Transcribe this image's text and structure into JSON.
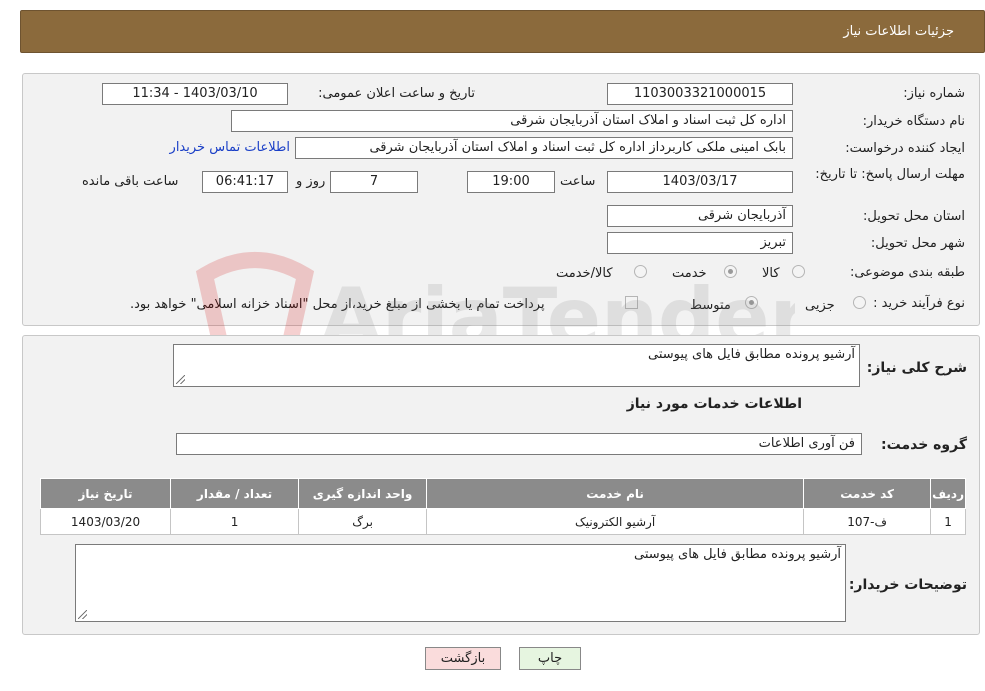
{
  "header": {
    "title": "جزئیات اطلاعات نیاز"
  },
  "form": {
    "need_number_label": "شماره نیاز:",
    "need_number": "1103003321000015",
    "announce_label": "تاریخ و ساعت اعلان عمومی:",
    "announce_value": "1403/03/10 - 11:34",
    "buyer_org_label": "نام دستگاه خریدار:",
    "buyer_org": "اداره کل ثبت اسناد و املاک استان آذربایجان شرقی",
    "creator_label": "ایجاد کننده درخواست:",
    "creator": "بابک امینی ملکی کاربرداز اداره کل ثبت اسناد و املاک استان آذربایجان شرقی",
    "contact_link": "اطلاعات تماس خریدار",
    "deadline_label": "مهلت ارسال پاسخ: تا تاریخ:",
    "deadline_date": "1403/03/17",
    "time_label": "ساعت",
    "deadline_time": "19:00",
    "days_value": "7",
    "days_label": "روز و",
    "remaining_time": "06:41:17",
    "remaining_label": "ساعت باقی مانده",
    "province_label": "استان محل تحویل:",
    "province": "آذربایجان شرقی",
    "city_label": "شهر محل تحویل:",
    "city": "تبریز",
    "category_label": "طبقه بندی موضوعی:",
    "category_options": [
      {
        "label": "کالا",
        "checked": false
      },
      {
        "label": "خدمت",
        "checked": true
      },
      {
        "label": "کالا/خدمت",
        "checked": false
      }
    ],
    "process_label": "نوع فرآیند خرید :",
    "process_options": [
      {
        "label": "جزیی",
        "checked": false
      },
      {
        "label": "متوسط",
        "checked": true
      }
    ],
    "payment_note": "پرداخت تمام یا بخشی از مبلغ خرید،از محل \"اسناد خزانه اسلامی\" خواهد بود."
  },
  "details": {
    "summary_label": "شرح کلی نیاز:",
    "summary": "آرشیو پرونده  مطابق فایل های پیوستی",
    "services_title": "اطلاعات خدمات مورد نیاز",
    "service_group_label": "گروه خدمت:",
    "service_group": "فن آوری اطلاعات",
    "table": {
      "headers": [
        "ردیف",
        "کد خدمت",
        "نام خدمت",
        "واحد اندازه گیری",
        "تعداد / مقدار",
        "تاریخ نیاز"
      ],
      "rows": [
        [
          "1",
          "ف-107",
          "آرشیو الکترونیک",
          "برگ",
          "1",
          "1403/03/20"
        ]
      ]
    },
    "buyer_notes_label": "توضیحات خریدار:",
    "buyer_notes": "آرشیو پرونده  مطابق فایل های پیوستی"
  },
  "buttons": {
    "print": "چاپ",
    "back": "بازگشت"
  },
  "watermark": "AriaTender.neT"
}
